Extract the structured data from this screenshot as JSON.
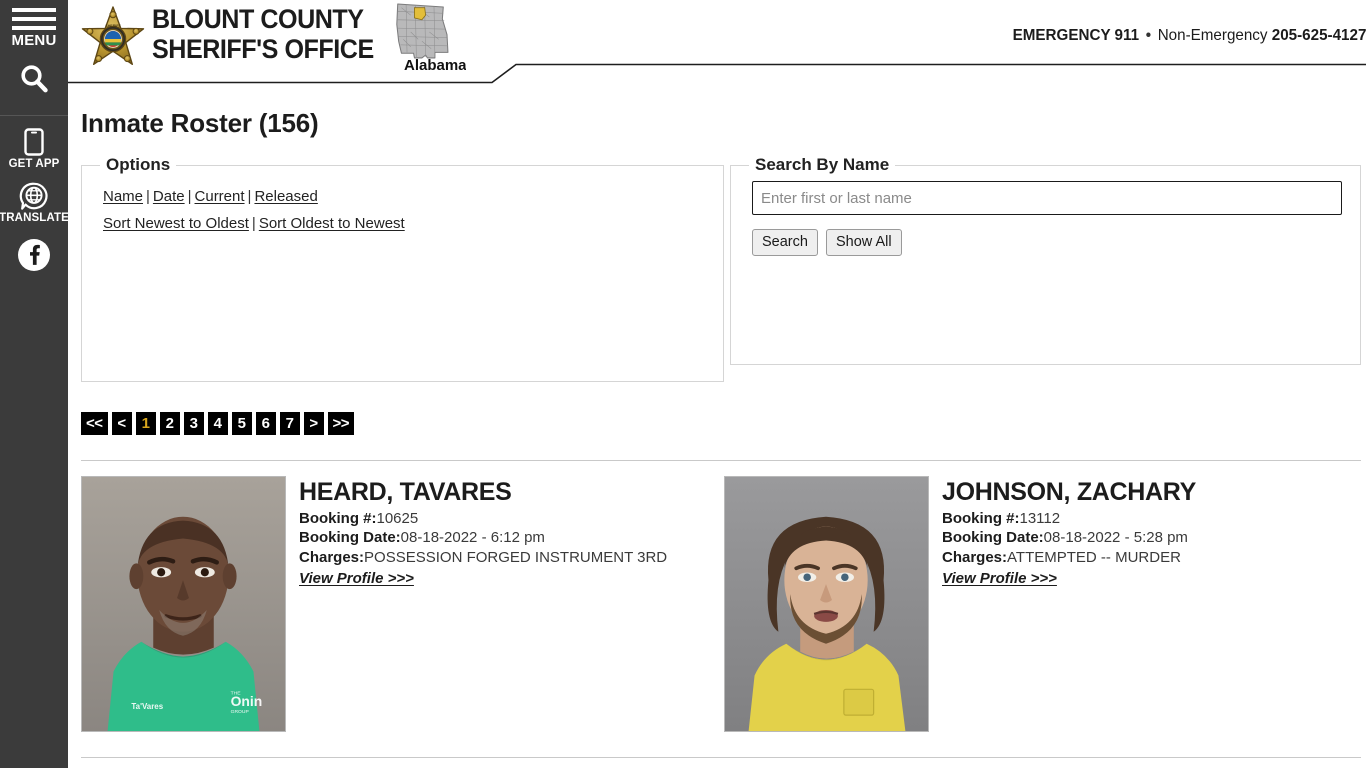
{
  "sidebar": {
    "menu_label": "MENU",
    "menu_icon": "hamburger-icon",
    "search_icon": "search-icon",
    "items": [
      {
        "label": "GET APP",
        "icon": "mobile-phone-icon"
      },
      {
        "label": "TRANSLATE",
        "icon": "globe-translate-icon"
      }
    ],
    "social": {
      "label": "Facebook",
      "icon": "facebook-icon"
    }
  },
  "header": {
    "badge_icon": "sheriff-star-badge-icon",
    "org_line1": "BLOUNT COUNTY",
    "org_line2": "SHERIFF'S OFFICE",
    "map_icon": "alabama-state-map-icon",
    "map_label": "Alabama",
    "emergency_label": "EMERGENCY 911",
    "separator": "•",
    "non_emergency_label": "Non-Emergency",
    "non_emergency_number": "205-625-4127"
  },
  "main": {
    "page_title": "Inmate Roster (156)",
    "options_panel": {
      "legend": "Options",
      "filter_links": [
        "Name",
        "Date",
        "Current",
        "Released"
      ],
      "sort_links": [
        "Sort Newest to Oldest",
        "Sort Oldest to Newest"
      ],
      "separator": "|"
    },
    "search_panel": {
      "legend": "Search By Name",
      "input_value": "",
      "input_placeholder": "Enter first or last name",
      "search_button": "Search",
      "show_all_button": "Show All"
    },
    "pagination": {
      "first": "<<",
      "prev": "<",
      "pages": [
        "1",
        "2",
        "3",
        "4",
        "5",
        "6",
        "7"
      ],
      "active_page": "1",
      "next": ">",
      "last": ">>",
      "active_color": "#d8a61d"
    },
    "labels": {
      "booking_number": "Booking #:",
      "booking_date": "Booking Date:",
      "charges": "Charges:",
      "view_profile": "View Profile >>>"
    },
    "inmates": [
      {
        "name": "HEARD, TAVARES",
        "booking_number": "10625",
        "booking_date": "08-18-2022 - 6:12 pm",
        "charges": "POSSESSION FORGED INSTRUMENT 3RD",
        "mugshot_alt": "Mugshot of HEARD, TAVARES",
        "shirt_color": "#2fbd8a",
        "background_color": "#9a958f",
        "skin_color": "#6b4a38"
      },
      {
        "name": "JOHNSON, ZACHARY",
        "booking_number": "13112",
        "booking_date": "08-18-2022 - 5:28 pm",
        "charges": "ATTEMPTED -- MURDER",
        "mugshot_alt": "Mugshot of JOHNSON, ZACHARY",
        "shirt_color": "#e3d14a",
        "background_color": "#8c8c8e",
        "skin_color": "#d9b396"
      }
    ]
  }
}
